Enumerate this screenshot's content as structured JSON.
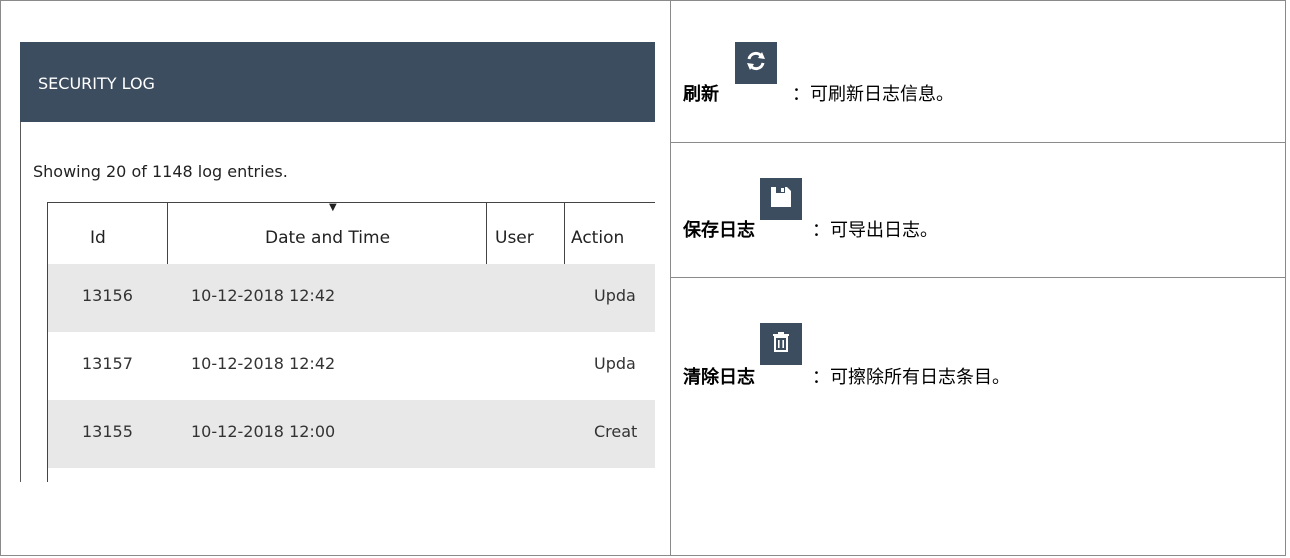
{
  "screenshot": {
    "title": "SECURITY LOG",
    "showing": "Showing 20 of 1148 log entries.",
    "columns": [
      "Id",
      "Date and Time",
      "User",
      "Action"
    ],
    "sort_indicator": "▼",
    "rows": [
      {
        "id": "13156",
        "datetime": "10-12-2018 12:42",
        "user": "",
        "action": "Upda"
      },
      {
        "id": "13157",
        "datetime": "10-12-2018 12:42",
        "user": "",
        "action": "Upda"
      },
      {
        "id": "13155",
        "datetime": "10-12-2018 12:00",
        "user": "",
        "action": "Creat"
      }
    ]
  },
  "descriptions": [
    {
      "label": "刷新",
      "icon": "refresh-icon",
      "text": "：可刷新日志信息。"
    },
    {
      "label": "保存日志",
      "icon": "save-icon",
      "text": "：可导出日志。"
    },
    {
      "label": "清除日志",
      "icon": "trash-icon",
      "text": "：可擦除所有日志条目。"
    }
  ],
  "colors": {
    "header_bg": "#3d4d60",
    "row_alt": "#e8e8e8",
    "icon_tile": "#3d4d60"
  }
}
